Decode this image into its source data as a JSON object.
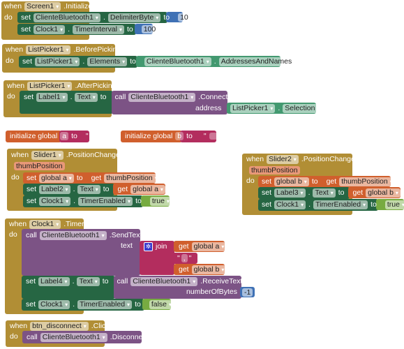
{
  "kw": {
    "when": "when",
    "do": "do",
    "set": "set",
    "to": "to",
    "call": "call",
    "get": "get",
    "dot": ".",
    "init": "initialize global",
    "q": "\""
  },
  "colors": {
    "event": "#b18e35",
    "component_set": "#266643",
    "component_get": "#439970",
    "procedure": "#7c5385",
    "math": "#3f71b5",
    "text": "#b32d5e",
    "variables": "#d05f2d",
    "logic": "#77ab41"
  },
  "screen_init": {
    "component": "Screen1",
    "event": ".Initialize",
    "s1": {
      "comp": "ClienteBluetooth1",
      "prop": "DelimiterByte",
      "value": "10"
    },
    "s2": {
      "comp": "Clock1",
      "prop": "TimerInterval",
      "value": "100"
    }
  },
  "before_picking": {
    "component": "ListPicker1",
    "event": ".BeforePicking",
    "comp": "ListPicker1",
    "prop": "Elements",
    "src_comp": "ClienteBluetooth1",
    "src_prop": "AddressesAndNames"
  },
  "after_picking": {
    "component": "ListPicker1",
    "event": ".AfterPicking",
    "comp": "Label1",
    "prop": "Text",
    "call_comp": "ClienteBluetooth1",
    "method": ".Connect",
    "arg": "address",
    "arg_comp": "ListPicker1",
    "arg_prop": "Selection"
  },
  "globals": [
    {
      "name": "a",
      "value": ""
    },
    {
      "name": "b",
      "value": ""
    }
  ],
  "slider1": {
    "component": "Slider1",
    "event": ".PositionChanged",
    "param": "thumbPosition",
    "var": "global a",
    "get_var": "thumbPosition",
    "label": "Label2",
    "prop": "Text",
    "get2": "global a",
    "clock": "Clock1",
    "clock_prop": "TimerEnabled",
    "bool": "true"
  },
  "slider2": {
    "component": "Slider2",
    "event": ".PositionChanged",
    "param": "thumbPosition",
    "var": "global b",
    "get_var": "thumbPosition",
    "label": "Label3",
    "prop": "Text",
    "get2": "global b",
    "clock": "Clock1",
    "clock_prop": "TimerEnabled",
    "bool": "true"
  },
  "timer": {
    "component": "Clock1",
    "event": ".Timer",
    "call_comp": "ClienteBluetooth1",
    "method": ".SendText",
    "arg": "text",
    "join": "join",
    "get_a": "global a",
    "sep": ",",
    "get_b": "global b",
    "label": "Label4",
    "prop": "Text",
    "recv_comp": "ClienteBluetooth1",
    "recv_method": ".ReceiveText",
    "recv_arg": "numberOfBytes",
    "recv_value": "-1",
    "clock": "Clock1",
    "clock_prop": "TimerEnabled",
    "bool": "false"
  },
  "disconnect": {
    "component": "btn_disconnect",
    "event": ".Click",
    "call_comp": "ClienteBluetooth1",
    "method": ".Disconnect"
  }
}
